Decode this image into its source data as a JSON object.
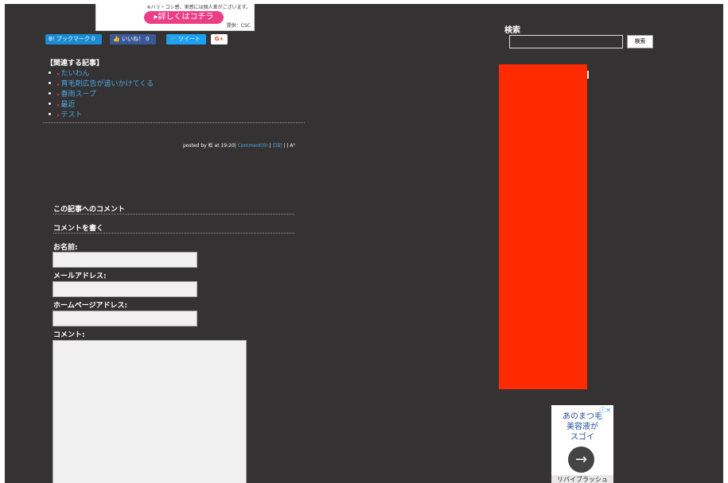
{
  "top_ad": {
    "note": "※ハリ・コシ感、実感には個人差がございます。",
    "cta": "詳しくはコチラ",
    "provider": "提供：CSC"
  },
  "share": {
    "hatena": "B! ブックマーク  0",
    "like": "いいね！ 0",
    "tweet": "ツイート",
    "gplus": "G+"
  },
  "related": {
    "title": "【関連する記事】",
    "items": [
      "たいわん",
      "育毛剤広告が追いかけてくる",
      "春雨スープ",
      "最近",
      "テスト"
    ]
  },
  "posted": {
    "prefix": "posted by 松 at 19:20|",
    "comments": "Comment(0)",
    "sep": " | ",
    "category": "日記",
    "suffix": " |  |"
  },
  "comments": {
    "section_title": "この記事へのコメント",
    "write_title": "コメントを書く",
    "name_label": "お名前:",
    "email_label": "メールアドレス:",
    "homepage_label": "ホームページアドレス:",
    "comment_label": "コメント:"
  },
  "search": {
    "title": "検索",
    "button": "検索"
  },
  "bottom_ad": {
    "headline_line1": "あのまつ毛",
    "headline_line2": "美容液が",
    "headline_line3": "スゴイ",
    "brand": "リバイブラッシュ",
    "ad_x": "ⓘ✕"
  },
  "colors": {
    "page_bg": "#343232",
    "link": "#4da8e8",
    "red_ad": "#ff2a00"
  }
}
